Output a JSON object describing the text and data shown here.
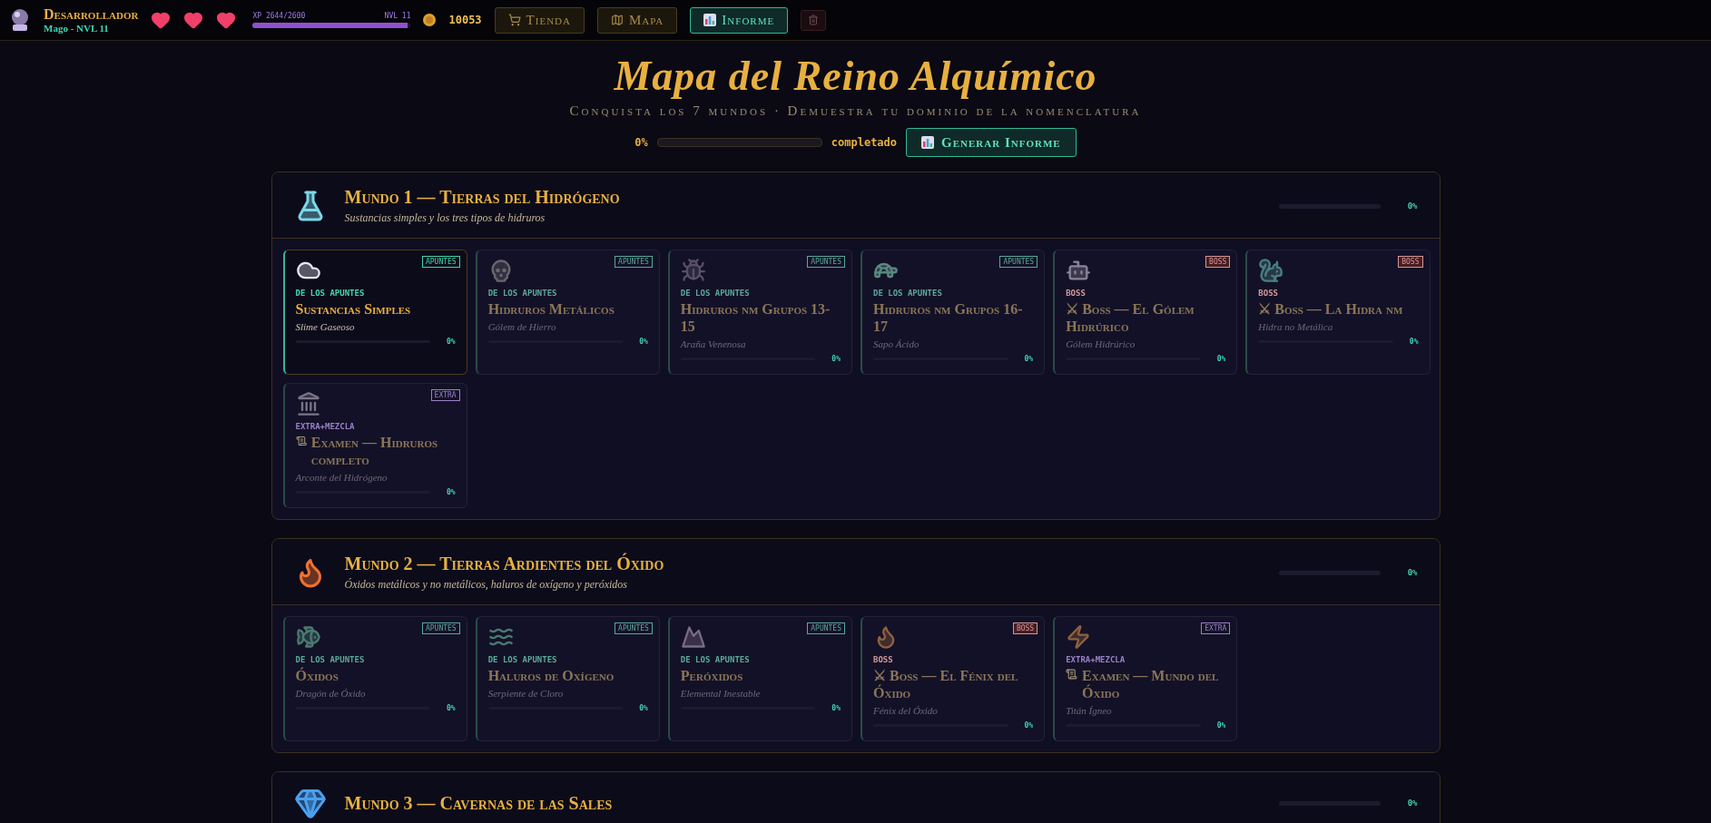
{
  "player": {
    "name": "Desarrollador",
    "subtitle": "Mago - NVL 11",
    "hearts": [
      {
        "filled": true
      },
      {
        "filled": true
      },
      {
        "filled": true
      }
    ],
    "xp": {
      "label": "XP 2644/2600",
      "level_label": "NVL 11",
      "level": 0.98
    },
    "coins": "10053"
  },
  "nav": [
    {
      "label": "Tienda",
      "selected": false
    },
    {
      "label": "Mapa",
      "selected": false
    },
    {
      "label": "Informe",
      "selected": true
    }
  ],
  "header": {
    "title": "Mapa del Reino Alquímico",
    "subtitle": "Conquista los 7 mundos · Demuestra tu dominio de la nomenclatura",
    "progress": {
      "percent": "0%",
      "level": 0,
      "label": "completado"
    },
    "report_button": "Generar Informe"
  },
  "worlds": [
    {
      "title": "Mundo 1 — Tierras del Hidrógeno",
      "subtitle": "Sustancias simples y los tres tipos de hidruros",
      "level": 0,
      "percent": "0%",
      "levels": [
        {
          "kind": "apuntes",
          "tag": "APUNTES",
          "category": "DE LOS APUNTES",
          "title": "Sustancias Simples",
          "enemy": "Slime Gaseoso",
          "level": 0,
          "percent": "0%",
          "locked": false
        },
        {
          "kind": "apuntes",
          "tag": "APUNTES",
          "category": "DE LOS APUNTES",
          "title": "Hidruros Metálicos",
          "enemy": "Gólem de Hierro",
          "level": 0,
          "percent": "0%",
          "locked": true
        },
        {
          "kind": "apuntes",
          "tag": "APUNTES",
          "category": "DE LOS APUNTES",
          "title": "Hidruros nm Grupos 13-15",
          "enemy": "Araña Venenosa",
          "level": 0,
          "percent": "0%",
          "locked": true
        },
        {
          "kind": "apuntes",
          "tag": "APUNTES",
          "category": "DE LOS APUNTES",
          "title": "Hidruros nm Grupos 16-17",
          "enemy": "Sapo Ácido",
          "level": 0,
          "percent": "0%",
          "locked": true
        },
        {
          "kind": "boss",
          "tag": "BOSS",
          "category": "BOSS",
          "title": "⚔ Boss — El Gólem Hidrúrico",
          "enemy": "Gólem Hidrúrico",
          "level": 0,
          "percent": "0%",
          "locked": true
        },
        {
          "kind": "boss",
          "tag": "BOSS",
          "category": "BOSS",
          "title": "⚔ Boss — La Hidra nm",
          "enemy": "Hidra no Metálica",
          "level": 0,
          "percent": "0%",
          "locked": true
        },
        {
          "kind": "extra",
          "tag": "EXTRA",
          "category": "EXTRA+MEZCLA",
          "title": "Examen — Hidruros completo",
          "enemy": "Arconte del Hidrógeno",
          "level": 0,
          "percent": "0%",
          "locked": true
        }
      ]
    },
    {
      "title": "Mundo 2 — Tierras Ardientes del Óxido",
      "subtitle": "Óxidos metálicos y no metálicos, haluros de oxígeno y peróxidos",
      "level": 0,
      "percent": "0%",
      "levels": [
        {
          "kind": "apuntes",
          "tag": "APUNTES",
          "category": "DE LOS APUNTES",
          "title": "Óxidos",
          "enemy": "Dragón de Óxido",
          "level": 0,
          "percent": "0%",
          "locked": true
        },
        {
          "kind": "apuntes",
          "tag": "APUNTES",
          "category": "DE LOS APUNTES",
          "title": "Haluros de Oxígeno",
          "enemy": "Serpiente de Cloro",
          "level": 0,
          "percent": "0%",
          "locked": true
        },
        {
          "kind": "apuntes",
          "tag": "APUNTES",
          "category": "DE LOS APUNTES",
          "title": "Peróxidos",
          "enemy": "Elemental Inestable",
          "level": 0,
          "percent": "0%",
          "locked": true
        },
        {
          "kind": "boss",
          "tag": "BOSS",
          "category": "BOSS",
          "title": "⚔ Boss — El Fénix del Óxido",
          "enemy": "Fénix del Óxido",
          "level": 0,
          "percent": "0%",
          "locked": true
        },
        {
          "kind": "extra",
          "tag": "EXTRA",
          "category": "EXTRA+MEZCLA",
          "title": "Examen — Mundo del Óxido",
          "enemy": "Titán Ígneo",
          "level": 0,
          "percent": "0%",
          "locked": true
        }
      ]
    },
    {
      "title": "Mundo 3 — Cavernas de las Sales",
      "level": 0,
      "percent": "0%"
    }
  ]
}
